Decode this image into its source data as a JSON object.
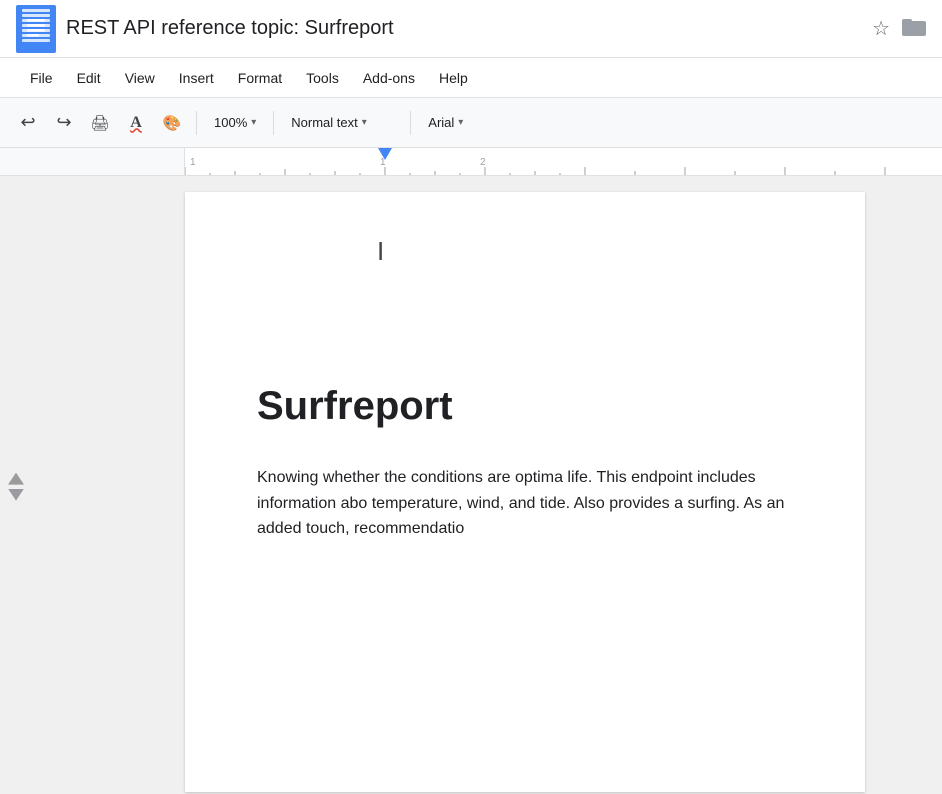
{
  "titleBar": {
    "appIcon": "docs-icon",
    "title": "REST API reference topic: Surfreport",
    "starIcon": "☆",
    "folderIcon": "▭"
  },
  "menuBar": {
    "items": [
      "File",
      "Edit",
      "View",
      "Insert",
      "Format",
      "Tools",
      "Add-ons",
      "Help"
    ]
  },
  "toolbar": {
    "undoLabel": "↩",
    "redoLabel": "↪",
    "zoomLevel": "100%",
    "zoomDropdownArrow": "▾",
    "textStyleLabel": "Normal text",
    "textStyleDropdownArrow": "▾",
    "fontLabel": "Arial",
    "fontDropdownArrow": "▾"
  },
  "document": {
    "titleText": "Surfreport",
    "bodyText": "Knowing whether the conditions are optima life. This endpoint includes information abo temperature, wind, and tide. Also provides a surfing. As an added touch, recommendatio"
  }
}
